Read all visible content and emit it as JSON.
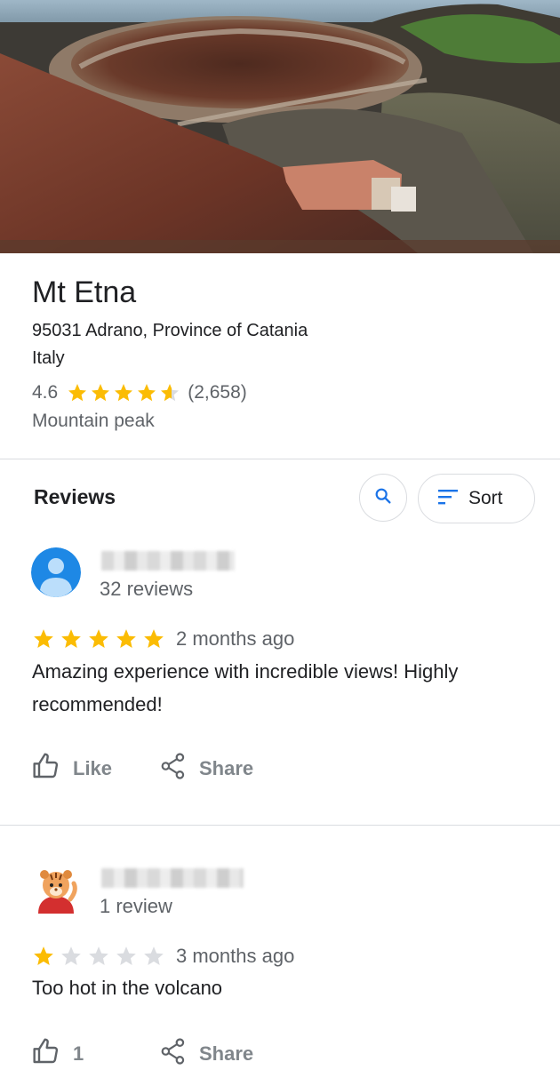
{
  "place": {
    "name": "Mt Etna",
    "address_line1": "95031 Adrano, Province of Catania",
    "address_line2": "Italy",
    "rating": "4.6",
    "rating_value": 4.6,
    "review_count": "(2,658)",
    "category": "Mountain peak"
  },
  "reviews_header": {
    "title": "Reviews",
    "sort_label": "Sort"
  },
  "reviews": [
    {
      "reviewer_count": "32 reviews",
      "stars": 5,
      "time_ago": "2 months ago",
      "text": "Amazing experience with incredible views!  Highly recommended!",
      "like_label": "Like",
      "share_label": "Share"
    },
    {
      "reviewer_count": "1 review",
      "stars": 1,
      "time_ago": "3 months ago",
      "text": "Too hot in the volcano",
      "like_label": "1",
      "share_label": "Share"
    }
  ],
  "colors": {
    "star_filled": "#fbbc04",
    "star_empty": "#dadce0",
    "accent_blue": "#1a73e8",
    "text_secondary": "#5f6368"
  },
  "icons": {
    "search": "search-icon",
    "sort": "sort-icon",
    "like": "thumb-up-icon",
    "share": "share-icon",
    "avatar1": "default-user-avatar",
    "avatar2": "tiger-character-avatar"
  }
}
